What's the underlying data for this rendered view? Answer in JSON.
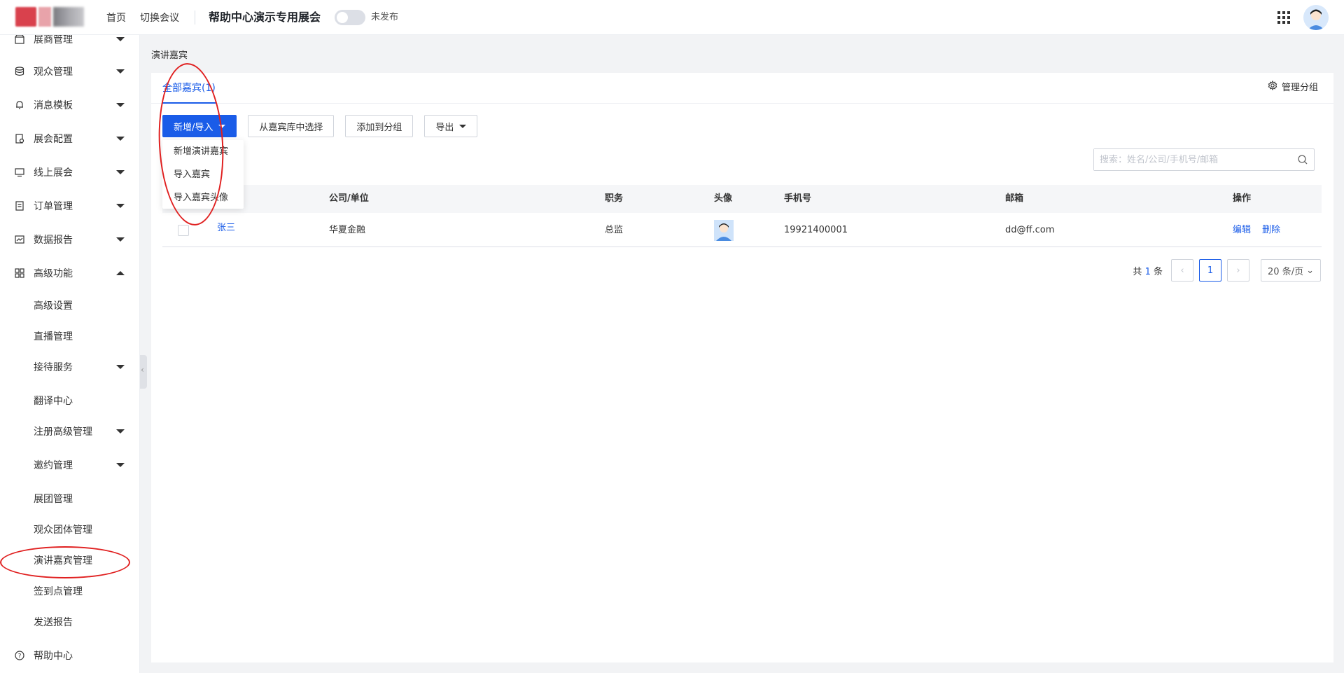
{
  "topbar": {
    "nav": [
      "首页",
      "切换会议"
    ],
    "expo_title": "帮助中心演示专用展会",
    "publish_status": "未发布"
  },
  "sidebar": {
    "items": [
      {
        "label": "展商管理",
        "icon": "shop-icon",
        "expandable": true
      },
      {
        "label": "观众管理",
        "icon": "database-icon",
        "expandable": true
      },
      {
        "label": "消息模板",
        "icon": "bell-icon",
        "expandable": true
      },
      {
        "label": "展会配置",
        "icon": "config-icon",
        "expandable": true
      },
      {
        "label": "线上展会",
        "icon": "monitor-icon",
        "expandable": true
      },
      {
        "label": "订单管理",
        "icon": "order-icon",
        "expandable": true
      },
      {
        "label": "数据报告",
        "icon": "chart-icon",
        "expandable": true
      },
      {
        "label": "高级功能",
        "icon": "apps-icon",
        "expandable": true,
        "expanded": true
      }
    ],
    "sub_items": [
      {
        "label": "高级设置",
        "expandable": false
      },
      {
        "label": "直播管理",
        "expandable": false
      },
      {
        "label": "接待服务",
        "expandable": true
      },
      {
        "label": "翻译中心",
        "expandable": false
      },
      {
        "label": "注册高级管理",
        "expandable": true
      },
      {
        "label": "邀约管理",
        "expandable": true
      },
      {
        "label": "展团管理",
        "expandable": false
      },
      {
        "label": "观众团体管理",
        "expandable": false
      },
      {
        "label": "演讲嘉宾管理",
        "expandable": false,
        "active": true
      },
      {
        "label": "签到点管理",
        "expandable": false
      },
      {
        "label": "发送报告",
        "expandable": false
      }
    ],
    "help": "帮助中心"
  },
  "page": {
    "breadcrumb": "演讲嘉宾",
    "tab": "全部嘉宾(1)",
    "manage_group": "管理分组",
    "toolbar": {
      "add_import": "新增/导入",
      "select_from_library": "从嘉宾库中选择",
      "add_to_group": "添加到分组",
      "export": "导出"
    },
    "dropdown": [
      "新增演讲嘉宾",
      "导入嘉宾",
      "导入嘉宾头像"
    ],
    "search_placeholder": "搜索：姓名/公司/手机号/邮箱",
    "table": {
      "headers": [
        "公司/单位",
        "职务",
        "头像",
        "手机号",
        "邮箱",
        "操作"
      ],
      "rows": [
        {
          "name": "张三",
          "company": "华夏金融",
          "title": "总监",
          "phone": "19921400001",
          "email": "dd@ff.com",
          "actions": [
            "编辑",
            "删除"
          ]
        }
      ]
    },
    "pagination": {
      "total_prefix": "共",
      "total": "1",
      "total_suffix": "条",
      "current_page": "1",
      "page_size": "20 条/页"
    }
  },
  "colors": {
    "primary": "#1a5ce8",
    "annotation": "#e02020"
  }
}
